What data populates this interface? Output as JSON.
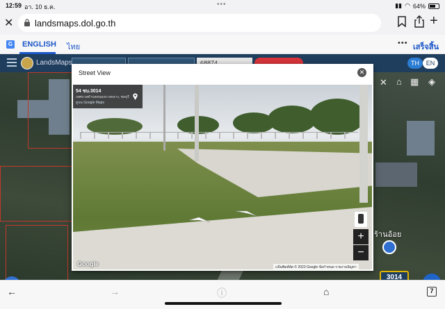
{
  "status_bar": {
    "time": "12:59",
    "date": "อา. 10 ธ.ค.",
    "battery": "64%",
    "battery_level": 0.64
  },
  "browser": {
    "url": "landsmaps.dol.go.th"
  },
  "translate_bar": {
    "english_label": "ENGLISH",
    "thai_label": "ไทย",
    "done_label": "เสร็จสิ้น"
  },
  "app_header": {
    "brand": "LandsMaps",
    "field_value": "68874",
    "lang_th": "TH",
    "lang_en": "EN"
  },
  "map": {
    "place_label": "ร้านอ้อย",
    "road_number": "3014"
  },
  "modal": {
    "title": "Street View",
    "street_view": {
      "address": "54 ชบ.3014",
      "subtitle": "เทศบาลตำบลหนองบางคลาง, ชลบุรี",
      "maps_link": "ดูบน Google Maps",
      "google_logo": "Google",
      "footer": "แป้นพิมพ์ลัด   © 2023 Google   ข้อกำหนด   รายงานปัญหา"
    }
  },
  "toolbar": {
    "tabs_count": "7"
  },
  "colors": {
    "app_header_bg": "#1f3e5e",
    "link_blue": "#1a56c8",
    "accent_red": "#d9343a",
    "road_badge_border": "#e0b400"
  }
}
